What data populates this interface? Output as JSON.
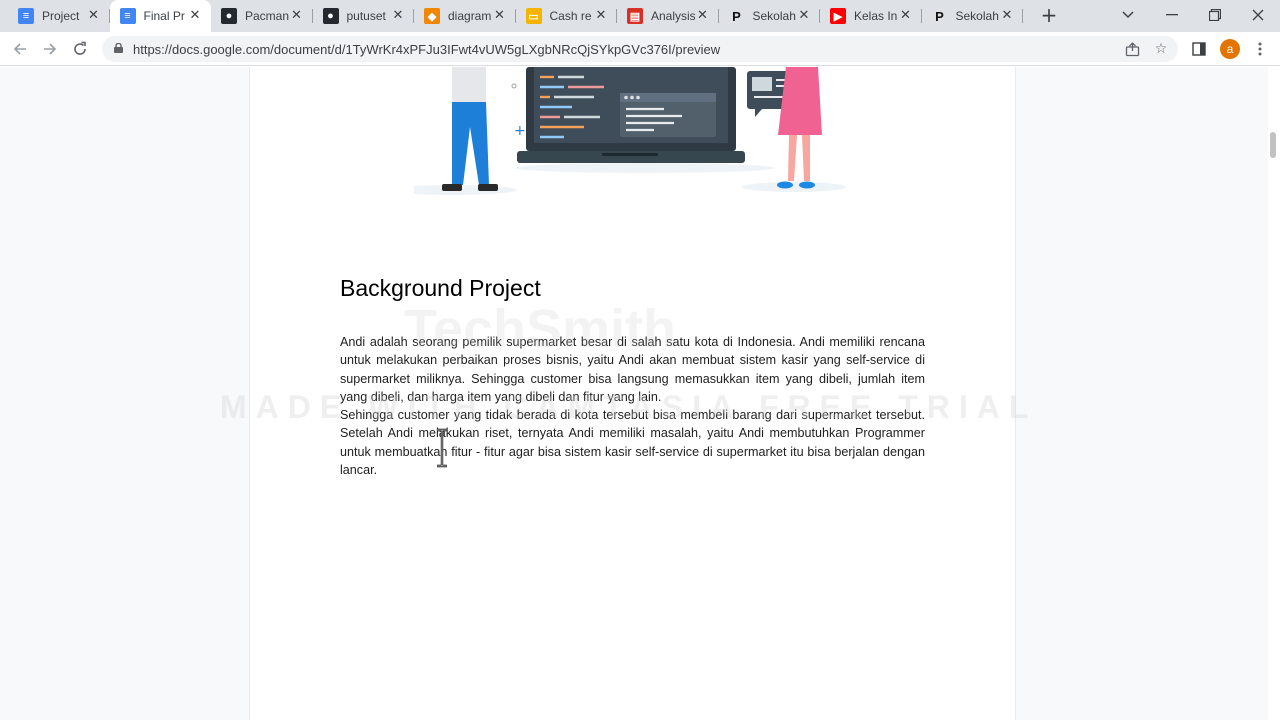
{
  "tabs": [
    {
      "label": "Project",
      "icon": "google-docs-icon",
      "color": "#4285f4",
      "active": false
    },
    {
      "label": "Final Pr",
      "icon": "google-docs-icon",
      "color": "#4285f4",
      "active": true
    },
    {
      "label": "Pacman",
      "icon": "github-icon",
      "color": "#24292f",
      "active": false
    },
    {
      "label": "putuset",
      "icon": "github-icon",
      "color": "#24292f",
      "active": false
    },
    {
      "label": "diagram",
      "icon": "drawio-icon",
      "color": "#f08705",
      "active": false
    },
    {
      "label": "Cash re",
      "icon": "slides-icon",
      "color": "#f4b400",
      "active": false
    },
    {
      "label": "Analysis",
      "icon": "analysis-icon",
      "color": "#d93025",
      "active": false
    },
    {
      "label": "Sekolah",
      "icon": "p-icon",
      "color": "#111111",
      "active": false
    },
    {
      "label": "Kelas In",
      "icon": "youtube-icon",
      "color": "#ff0000",
      "active": false
    },
    {
      "label": "Sekolah",
      "icon": "p-icon",
      "color": "#111111",
      "active": false
    }
  ],
  "address_bar": {
    "url": "https://docs.google.com/document/d/1TyWrKr4xPFJu3IFwt4vUW5gLXgbNRcQjSYkpGVc376I/preview"
  },
  "profile": {
    "initial": "a",
    "color": "#e37400"
  },
  "document": {
    "heading": "Background Project",
    "paragraph1": "Andi adalah seorang pemilik supermarket besar di salah satu kota di Indonesia. Andi memiliki rencana untuk melakukan perbaikan proses bisnis, yaitu Andi akan membuat sistem kasir yang self-service di supermarket miliknya. Sehingga customer bisa langsung memasukkan item yang dibeli, jumlah item yang dibeli, dan harga item yang dibeli dan fitur yang lain.",
    "paragraph2": "Sehingga customer yang tidak berada di kota tersebut bisa membeli barang dari supermarket tersebut. Setelah Andi melakukan riset, ternyata Andi memiliki masalah, yaitu Andi membutuhkan Programmer untuk membuatkan fitur - fitur agar bisa sistem kasir self-service di supermarket itu bisa berjalan dengan lancar."
  },
  "watermark": {
    "brand": "TechSmith",
    "trial_text": "MADE WITH CAMTASIA FREE TRIAL"
  }
}
